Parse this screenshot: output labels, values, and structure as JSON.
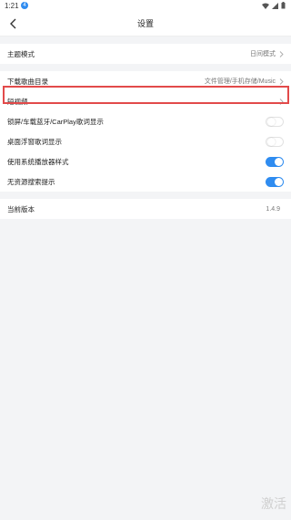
{
  "status": {
    "time": "1:21",
    "notification_badge": "4"
  },
  "nav": {
    "title": "设置"
  },
  "rows_group1": [
    {
      "label": "主题模式",
      "value": "日间模式",
      "type": "nav"
    }
  ],
  "rows_group2": [
    {
      "label": "下载歌曲目录",
      "value": "文件管理/手机存储/Music",
      "type": "nav"
    },
    {
      "label": "短视频",
      "value": "",
      "type": "nav",
      "highlighted": true
    },
    {
      "label": "锁屏/车载蓝牙/CarPlay歌词显示",
      "type": "toggle",
      "on": false
    },
    {
      "label": "桌面浮窗歌词显示",
      "type": "toggle",
      "on": false
    },
    {
      "label": "使用系统播放器样式",
      "type": "toggle",
      "on": true
    },
    {
      "label": "无资源搜索提示",
      "type": "toggle",
      "on": true
    }
  ],
  "rows_group3": [
    {
      "label": "当前版本",
      "value": "1.4.9",
      "type": "info"
    }
  ],
  "watermark": "激活",
  "colors": {
    "accent": "#2f8cf0",
    "highlight": "#e24a4a"
  }
}
